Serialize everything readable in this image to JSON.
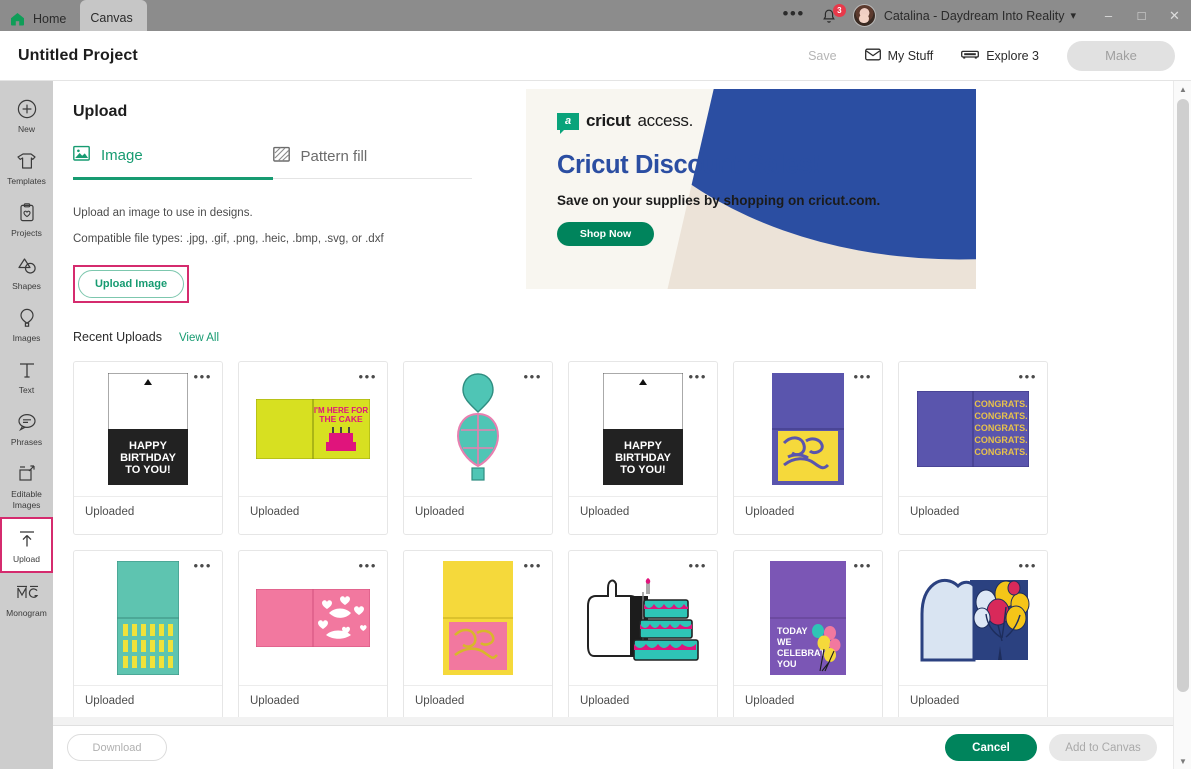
{
  "titlebar": {
    "tabs": [
      {
        "label": "Home",
        "icon": "home-icon",
        "active": false
      },
      {
        "label": "Canvas",
        "icon": "canvas-icon",
        "active": true
      }
    ],
    "overflow_icon": "more-horizontal-icon",
    "notifications_icon": "bell-icon",
    "notification_count": "3",
    "avatar_icon": "user-avatar",
    "account_name": "Catalina - Daydream Into Reality",
    "account_caret_icon": "chevron-down-icon",
    "window_minimize": "–",
    "window_maximize": "□",
    "window_close": "✕"
  },
  "header": {
    "project_title": "Untitled Project",
    "save_label": "Save",
    "my_stuff_label": "My Stuff",
    "my_stuff_icon": "envelope-icon",
    "explore_label": "Explore 3",
    "explore_icon": "machine-icon",
    "make_label": "Make"
  },
  "sidebar": {
    "items": [
      {
        "label": "New",
        "icon": "plus-circle-icon",
        "selected": false
      },
      {
        "label": "Templates",
        "icon": "tshirt-icon",
        "selected": false
      },
      {
        "label": "Projects",
        "icon": "clipboard-heart-icon",
        "selected": false
      },
      {
        "label": "Shapes",
        "icon": "shapes-icon",
        "selected": false
      },
      {
        "label": "Images",
        "icon": "hot-air-balloon-icon",
        "selected": false
      },
      {
        "label": "Text",
        "icon": "text-t-icon",
        "selected": false
      },
      {
        "label": "Phrases",
        "icon": "speech-bubble-icon",
        "selected": false
      },
      {
        "label": "Editable Images",
        "icon": "editable-images-icon",
        "selected": false
      },
      {
        "label": "Upload",
        "icon": "upload-arrow-icon",
        "selected": true
      },
      {
        "label": "Monogram",
        "icon": "monogram-mg-icon",
        "selected": false
      }
    ]
  },
  "panel": {
    "title": "Upload",
    "tabs": [
      {
        "label": "Image",
        "icon": "picture-icon",
        "active": true
      },
      {
        "label": "Pattern fill",
        "icon": "pattern-swatch-icon",
        "active": false
      }
    ],
    "description_line1": "Upload an image to use in designs.",
    "description_line2": "Compatible file types: .jpg, .gif, .png, .heic, .bmp, .svg, or .dxf",
    "upload_button_label": "Upload Image",
    "recent_uploads_label": "Recent Uploads",
    "view_all_label": "View All"
  },
  "banner": {
    "brand_bold": "cricut",
    "brand_light": "access.",
    "brand_mark_letter": "a",
    "headline": "Cricut Discount Sales!",
    "subhead": "Save on your supplies by shopping on cricut.com.",
    "cta_label": "Shop Now",
    "colors": {
      "blue": "#2b4ea2",
      "beige": "#ece3d8",
      "green": "#00845c"
    }
  },
  "grid": {
    "status_label": "Uploaded",
    "menu_icon": "more-horizontal-icon",
    "items": [
      {
        "id": "happy-birthday-to-you-card",
        "status": "Uploaded",
        "art": "happy-birthday-black"
      },
      {
        "id": "im-here-for-the-cake-card",
        "status": "Uploaded",
        "art": "cake-lime-card"
      },
      {
        "id": "hot-air-balloon",
        "status": "Uploaded",
        "art": "balloon-teal"
      },
      {
        "id": "happy-birthday-to-you-card-2",
        "status": "Uploaded",
        "art": "happy-birthday-black"
      },
      {
        "id": "happy-birthday-gold-card",
        "status": "Uploaded",
        "art": "happy-birthday-gold"
      },
      {
        "id": "congrats-card",
        "status": "Uploaded",
        "art": "congrats-purple"
      },
      {
        "id": "teal-pattern-card",
        "status": "Uploaded",
        "art": "teal-pattern"
      },
      {
        "id": "pink-hearts-card",
        "status": "Uploaded",
        "art": "pink-hearts"
      },
      {
        "id": "yellow-pink-script-card",
        "status": "Uploaded",
        "art": "yellow-pink-script"
      },
      {
        "id": "tiered-cake",
        "status": "Uploaded",
        "art": "tiered-cake"
      },
      {
        "id": "today-we-celebrate-you-card",
        "status": "Uploaded",
        "art": "celebrate-purple"
      },
      {
        "id": "balloons-arch-card",
        "status": "Uploaded",
        "art": "balloons-navy"
      }
    ],
    "thumbnail_text": {
      "happy_birthday": "HAPPY BIRTHDAY TO YOU!",
      "cake_card": "I'M HERE FOR THE CAKE",
      "congrats": "CONGRATS.",
      "celebrate": "TODAY WE CELEBRATE YOU"
    }
  },
  "bottombar": {
    "download_label": "Download",
    "cancel_label": "Cancel",
    "add_to_canvas_label": "Add to Canvas"
  },
  "scrollbar": {
    "up_icon": "chevron-up-icon",
    "down_icon": "chevron-down-icon"
  },
  "accents": {
    "green": "#179b71",
    "dark_green": "#00845c",
    "highlight_pink": "#d52b6e",
    "badge_red": "#e8394a"
  }
}
